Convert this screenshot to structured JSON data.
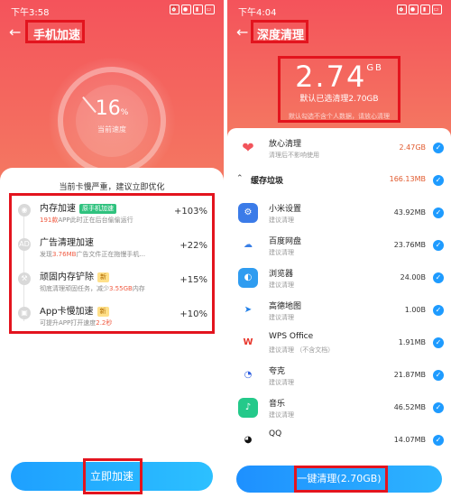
{
  "left": {
    "status_time": "下午3:58",
    "title": "手机加速",
    "gauge_value": "16",
    "gauge_unit": "%",
    "gauge_label": "当前速度",
    "warning": "当前卡慢严重，建议立即优化",
    "items": [
      {
        "name": "内存加速",
        "tag": "原手机加速",
        "desc_pre": "",
        "desc_em": "",
        "desc_post": "",
        "desc_prefix_em": "191款",
        "desc_suffix": "APP此时正在后台偷偷运行",
        "value": "+103%",
        "icon": "memory-icon"
      },
      {
        "name": "广告清理加速",
        "tag": "",
        "desc_prefix": "发现",
        "desc_em": "3.76MB",
        "desc_suffix": "广告文件正在拖慢手机...",
        "value": "+22%",
        "icon": "ad-icon"
      },
      {
        "name": "顽固内存铲除",
        "tag": "新",
        "desc_prefix": "彻底清理顽固任务，减少",
        "desc_em": "3.55GB",
        "desc_suffix": "内存",
        "value": "+15%",
        "icon": "shovel-icon"
      },
      {
        "name": "App卡慢加速",
        "tag": "新",
        "desc_prefix": "可提升APP打开速度",
        "desc_em": "2.2秒",
        "desc_suffix": "",
        "value": "+10%",
        "icon": "app-speed-icon"
      }
    ],
    "button": "立即加速"
  },
  "right": {
    "status_time": "下午4:04",
    "title": "深度清理",
    "big_value": "2.74",
    "big_unit": "GB",
    "sub": "默认已选清理2.70GB",
    "note": "默认勾选不含个人数据，请放心清理",
    "safe": {
      "name": "放心清理",
      "desc": "清理后不影响使用",
      "size": "2.47GB"
    },
    "category": {
      "name": "缓存垃圾",
      "size": "166.13MB"
    },
    "apps": [
      {
        "name": "小米设置",
        "desc": "建议清理",
        "size": "43.92MB",
        "color": "#3b7be8",
        "glyph": "⚙",
        "icon": "settings-icon"
      },
      {
        "name": "百度网盘",
        "desc": "建议清理",
        "size": "23.76MB",
        "color": "#ffffff",
        "glyph": "☁",
        "icon": "cloud-icon"
      },
      {
        "name": "浏览器",
        "desc": "建议清理",
        "size": "24.00B",
        "color": "#2f9cf0",
        "glyph": "◐",
        "icon": "browser-icon"
      },
      {
        "name": "高德地图",
        "desc": "建议清理",
        "size": "1.00B",
        "color": "#ffffff",
        "glyph": "➤",
        "icon": "map-icon"
      },
      {
        "name": "WPS Office",
        "desc": "建议清理 （不含文档）",
        "size": "1.91MB",
        "color": "#ffffff",
        "glyph": "W",
        "icon": "wps-icon"
      },
      {
        "name": "夸克",
        "desc": "建议清理",
        "size": "21.87MB",
        "color": "#ffffff",
        "glyph": "◔",
        "icon": "quark-icon"
      },
      {
        "name": "音乐",
        "desc": "建议清理",
        "size": "46.52MB",
        "color": "#24c98a",
        "glyph": "♪",
        "icon": "music-icon"
      },
      {
        "name": "QQ",
        "desc": "",
        "size": "14.07MB",
        "color": "#ffffff",
        "glyph": "🐧",
        "icon": "qq-icon"
      }
    ],
    "button": "一键清理(2.70GB)"
  }
}
